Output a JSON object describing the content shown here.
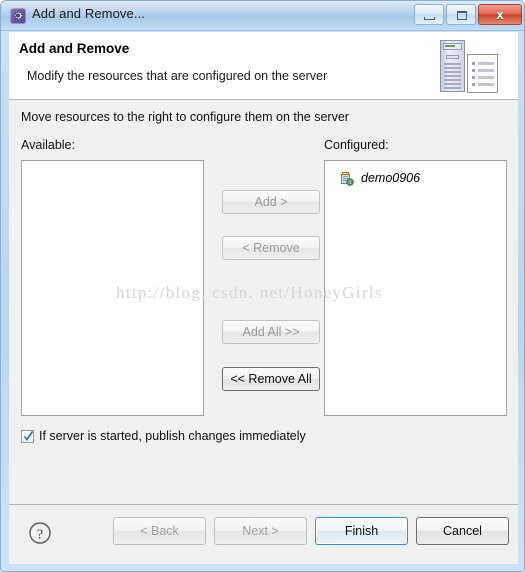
{
  "window": {
    "title": "Add and Remove...",
    "icon": "gear-icon",
    "controls": {
      "minimize": "–",
      "maximize": "□",
      "close": "x"
    }
  },
  "banner": {
    "title": "Add and Remove",
    "subtitle": "Modify the resources that are configured on the server",
    "icon": "server-and-document-icon"
  },
  "body": {
    "instruction": "Move resources to the right to configure them on the server",
    "available_label": "Available:",
    "configured_label": "Configured:",
    "available_items": [],
    "configured_items": [
      {
        "label": "demo0906",
        "icon": "web-module-icon"
      }
    ],
    "watermark": "http://blog. csdn. net/HoneyGirls",
    "transfer_buttons": [
      {
        "label": "Add >",
        "enabled": false
      },
      {
        "label": "< Remove",
        "enabled": false
      },
      {
        "label": "Add All >>",
        "enabled": false
      },
      {
        "label": "<< Remove All",
        "enabled": true
      }
    ],
    "publish_checkbox": {
      "label": "If server is started, publish changes immediately",
      "checked": true
    }
  },
  "footer": {
    "help_icon": "help-question-icon",
    "buttons": [
      {
        "label": "< Back",
        "enabled": false,
        "default": false
      },
      {
        "label": "Next >",
        "enabled": false,
        "default": false
      },
      {
        "label": "Finish",
        "enabled": true,
        "default": true
      },
      {
        "label": "Cancel",
        "enabled": true,
        "default": false
      }
    ]
  },
  "colors": {
    "window_frame": "#8ab0d4",
    "titlebar_top": "#dce9f6",
    "close_button": "#c9442e",
    "default_button_border": "#3c93c2",
    "checkbox_tick": "#2a6fb5",
    "content_bg": "#f0f0f0",
    "watermark": "#d6d6d6"
  }
}
